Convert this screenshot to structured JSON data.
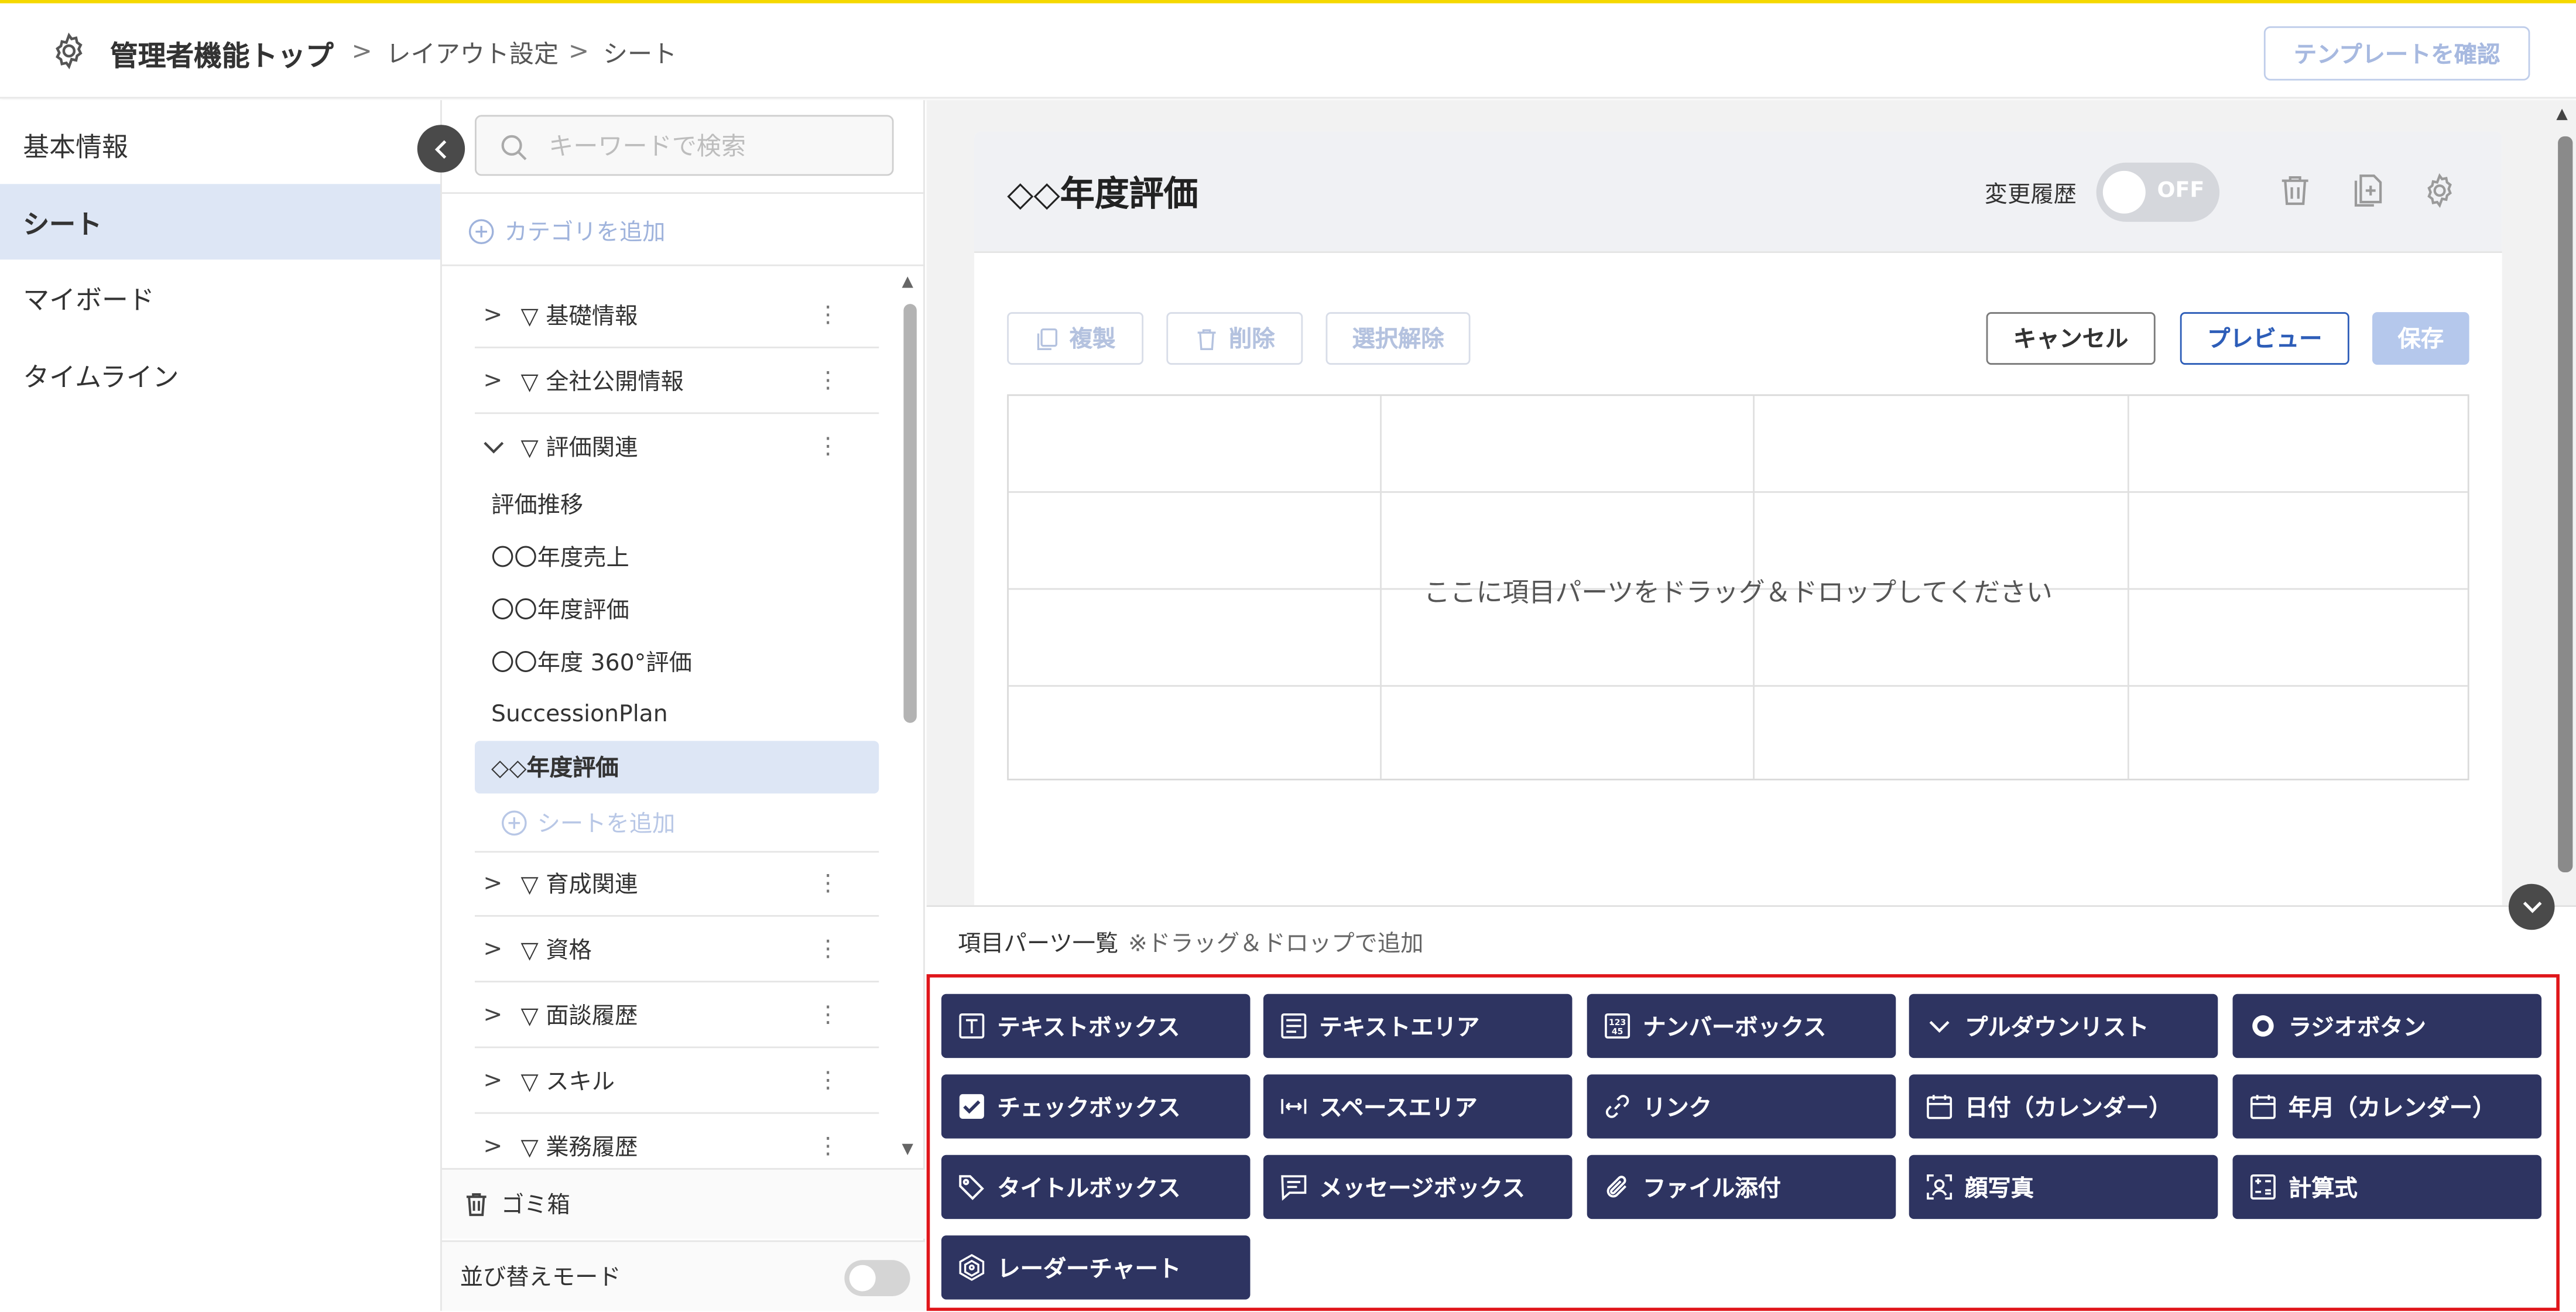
{
  "header": {
    "title": "管理者機能トップ",
    "breadcrumb": [
      "レイアウト設定",
      "シート"
    ],
    "template_button": "テンプレートを確認"
  },
  "left_nav": {
    "items": [
      {
        "label": "基本情報",
        "active": false
      },
      {
        "label": "シート",
        "active": true
      },
      {
        "label": "マイボード",
        "active": false
      },
      {
        "label": "タイムライン",
        "active": false
      }
    ]
  },
  "category_panel": {
    "search_placeholder": "キーワードで検索",
    "add_category": "カテゴリを追加",
    "categories_top": [
      {
        "label": "▽ 基礎情報",
        "expanded": false
      },
      {
        "label": "▽ 全社公開情報",
        "expanded": false
      },
      {
        "label": "▽ 評価関連",
        "expanded": true
      }
    ],
    "sheets": [
      {
        "label": "評価推移",
        "selected": false
      },
      {
        "label": "〇〇年度売上",
        "selected": false
      },
      {
        "label": "〇〇年度評価",
        "selected": false
      },
      {
        "label": "〇〇年度 360°評価",
        "selected": false
      },
      {
        "label": "SuccessionPlan",
        "selected": false
      },
      {
        "label": "◇◇年度評価",
        "selected": true
      }
    ],
    "add_sheet": "シートを追加",
    "categories_bottom": [
      {
        "label": "▽ 育成関連"
      },
      {
        "label": "▽ 資格"
      },
      {
        "label": "▽ 面談履歴"
      },
      {
        "label": "▽ スキル"
      },
      {
        "label": "▽ 業務履歴"
      }
    ],
    "trash": "ゴミ箱",
    "sort_mode": "並び替えモード"
  },
  "sheet": {
    "title": "◇◇年度評価",
    "history_label": "変更履歴",
    "history_toggle": "OFF",
    "toolbar": {
      "duplicate": "複製",
      "delete": "削除",
      "deselect": "選択解除",
      "cancel": "キャンセル",
      "preview": "プレビュー",
      "save": "保存"
    },
    "drop_message": "ここに項目パーツをドラッグ＆ドロップしてください"
  },
  "parts": {
    "title": "項目パーツ一覧",
    "note": "※ドラッグ＆ドロップで追加",
    "items": [
      {
        "label": "テキストボックス",
        "icon": "text-box-icon"
      },
      {
        "label": "テキストエリア",
        "icon": "text-area-icon"
      },
      {
        "label": "ナンバーボックス",
        "icon": "number-box-icon"
      },
      {
        "label": "プルダウンリスト",
        "icon": "chevron-down-icon"
      },
      {
        "label": "ラジオボタン",
        "icon": "radio-icon"
      },
      {
        "label": "チェックボックス",
        "icon": "checkbox-icon"
      },
      {
        "label": "スペースエリア",
        "icon": "space-area-icon"
      },
      {
        "label": "リンク",
        "icon": "link-icon"
      },
      {
        "label": "日付（カレンダー）",
        "icon": "calendar-icon"
      },
      {
        "label": "年月（カレンダー）",
        "icon": "calendar-icon"
      },
      {
        "label": "タイトルボックス",
        "icon": "tag-icon"
      },
      {
        "label": "メッセージボックス",
        "icon": "message-icon"
      },
      {
        "label": "ファイル添付",
        "icon": "paperclip-icon"
      },
      {
        "label": "顔写真",
        "icon": "face-photo-icon"
      },
      {
        "label": "計算式",
        "icon": "calculator-icon"
      },
      {
        "label": "レーダーチャート",
        "icon": "radar-chart-icon"
      }
    ]
  },
  "colors": {
    "accent_yellow": "#f5d800",
    "part_button": "#2e3461",
    "primary_blue": "#2d5db8",
    "highlight_red": "#e0161b",
    "selected_bg": "#dde6f5"
  }
}
